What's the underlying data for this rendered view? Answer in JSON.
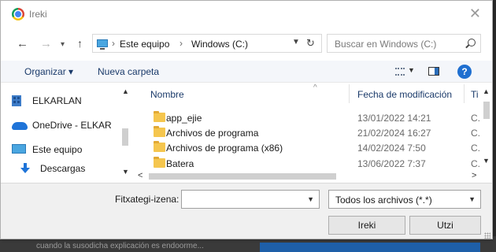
{
  "window": {
    "title": "Ireki",
    "close_icon": "close-icon"
  },
  "address": {
    "breadcrumb": [
      "Este equipo",
      "Windows (C:)"
    ],
    "breadcrumb_separator": "›",
    "search_placeholder": "Buscar en Windows (C:)"
  },
  "toolbar": {
    "organize_label": "Organizar ▾",
    "new_folder_label": "Nueva carpeta",
    "help_label": "?"
  },
  "sidebar": {
    "items": [
      {
        "label": "ELKARLAN",
        "icon": "building-icon"
      },
      {
        "label": "OneDrive - ELKAR",
        "icon": "cloud-icon"
      },
      {
        "label": "Este equipo",
        "icon": "computer-icon"
      },
      {
        "label": "Descargas",
        "icon": "download-icon"
      }
    ]
  },
  "files": {
    "columns": {
      "name": "Nombre",
      "date": "Fecha de modificación",
      "type": "Ti"
    },
    "rows": [
      {
        "name": "app_ejie",
        "date": "13/01/2022 14:21",
        "type": "C."
      },
      {
        "name": "Archivos de programa",
        "date": "21/02/2024 16:27",
        "type": "C."
      },
      {
        "name": "Archivos de programa (x86)",
        "date": "14/02/2024 7:50",
        "type": "C."
      },
      {
        "name": "Batera",
        "date": "13/06/2022 7:37",
        "type": "C."
      }
    ]
  },
  "footer": {
    "filename_label": "Fitxategi-izena:",
    "filename_value": "",
    "filter_value": "Todos los archivos (*.*)",
    "open_label": "Ireki",
    "cancel_label": "Utzi"
  },
  "background": {
    "text": "cuando la susodicha explicación es endoorme..."
  },
  "colors": {
    "accent": "#1f6fd0",
    "folder": "#f5c64e",
    "link_text": "#1a3a6a"
  }
}
